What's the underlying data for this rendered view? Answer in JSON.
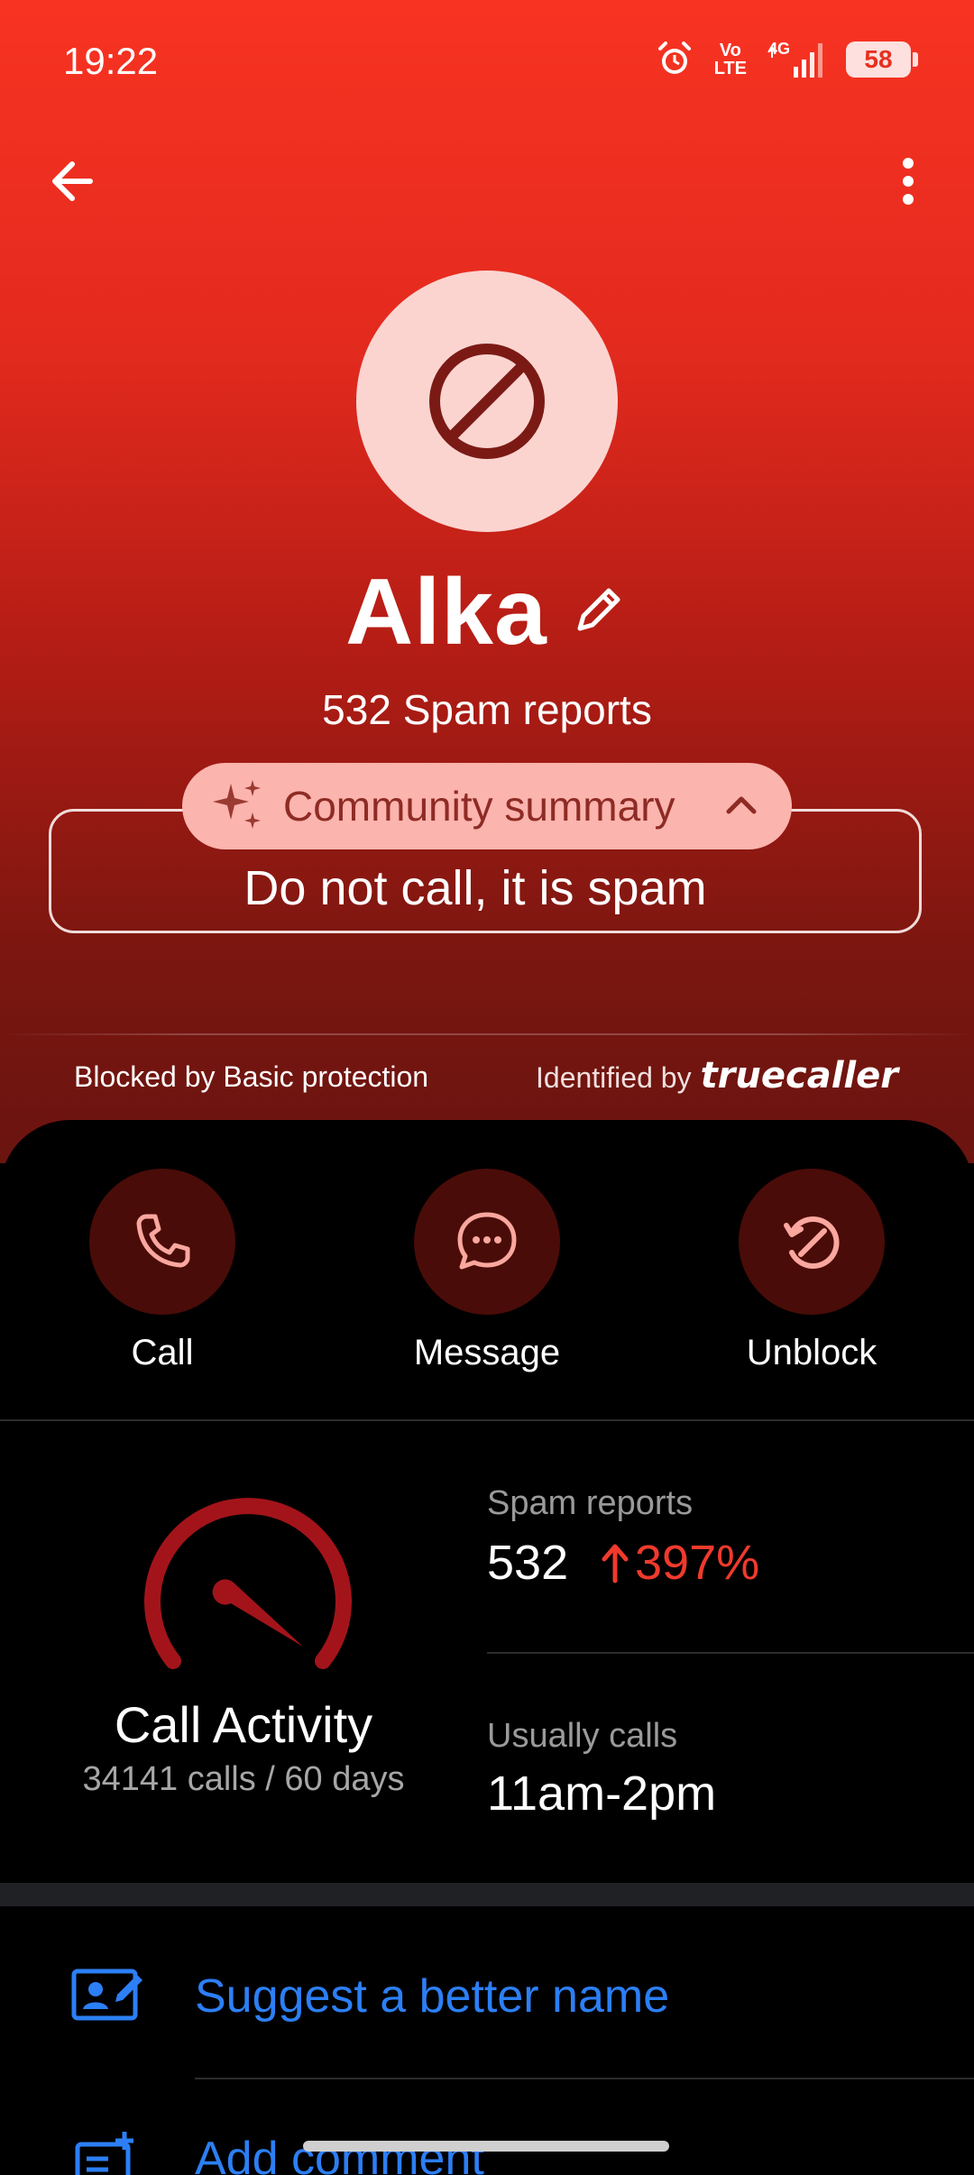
{
  "status_bar": {
    "time": "19:22",
    "network": "4G",
    "volte_top": "Vo",
    "volte_bottom": "LTE",
    "battery": "58"
  },
  "header": {
    "back_icon": "arrow-left-icon",
    "more_icon": "more-vertical-icon"
  },
  "profile": {
    "avatar_icon": "block-icon",
    "name": "Alka",
    "edit_icon": "pencil-icon",
    "spam_reports_label": "532 Spam reports"
  },
  "community_summary": {
    "label": "Community summary",
    "text": "Do not call, it is spam",
    "icon": "sparkle-icon",
    "chevron": "chevron-up-icon"
  },
  "protection": {
    "blocked_text": "Blocked by Basic protection",
    "identified_text": "Identified by",
    "brand": "truecaller"
  },
  "actions": [
    {
      "label": "Call",
      "icon": "phone-icon"
    },
    {
      "label": "Message",
      "icon": "chat-bubble-icon"
    },
    {
      "label": "Unblock",
      "icon": "unblock-icon"
    }
  ],
  "call_activity": {
    "title": "Call Activity",
    "subtitle": "34141 calls / 60 days",
    "spam_reports_label": "Spam reports",
    "spam_reports_value": "532",
    "spam_reports_change": "397%",
    "usually_calls_label": "Usually calls",
    "usually_calls_value": "11am-2pm"
  },
  "list_items": [
    {
      "label": "Suggest a better name",
      "icon": "contact-card-edit-icon"
    },
    {
      "label": "Add comment",
      "icon": "add-note-icon"
    }
  ],
  "colors": {
    "accent_red": "#f83322",
    "link_blue": "#2c7ff5",
    "action_circle": "#4a0c08",
    "change_red": "#f03a2c"
  }
}
